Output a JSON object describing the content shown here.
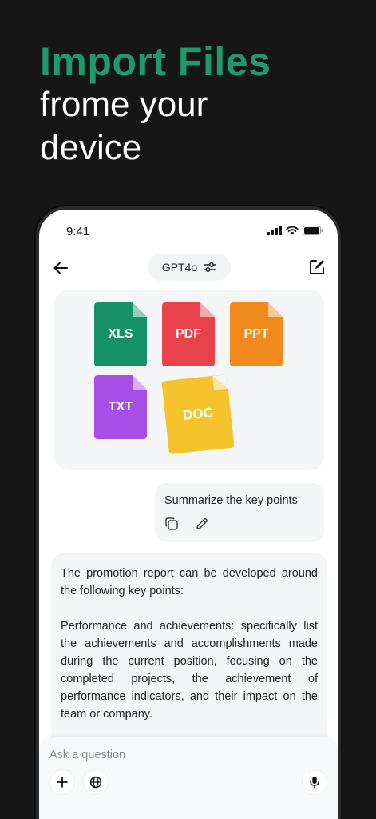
{
  "headline": {
    "accent": "Import Files",
    "line2": "frome your",
    "line3": "device"
  },
  "status_bar": {
    "time": "9:41"
  },
  "nav": {
    "model_label": "GPT4o"
  },
  "files": [
    {
      "label": "XLS",
      "color": "#149166"
    },
    {
      "label": "PDF",
      "color": "#e8434b"
    },
    {
      "label": "PPT",
      "color": "#f08a1c"
    },
    {
      "label": "TXT",
      "color": "#a64ee6"
    },
    {
      "label": "DOC",
      "color": "#f5c32c"
    }
  ],
  "user_message": {
    "text": "Summarize the key points"
  },
  "assistant_reply": {
    "paragraph1": "The promotion report can be developed around the following key points:",
    "paragraph2": "Performance and achievements: specifically list the achievements and accomplishments made during the current position, focusing on the completed projects, the achievement of performance indicators, and their impact on the team or company."
  },
  "composer": {
    "placeholder": "Ask a question"
  },
  "colors": {
    "accent": "#1f9a6e",
    "background": "#161616"
  },
  "icons": [
    "back-arrow-icon",
    "sliders-icon",
    "compose-icon",
    "copy-icon",
    "pencil-icon",
    "plus-icon",
    "globe-icon",
    "microphone-icon",
    "signal-icon",
    "wifi-icon",
    "battery-icon"
  ]
}
